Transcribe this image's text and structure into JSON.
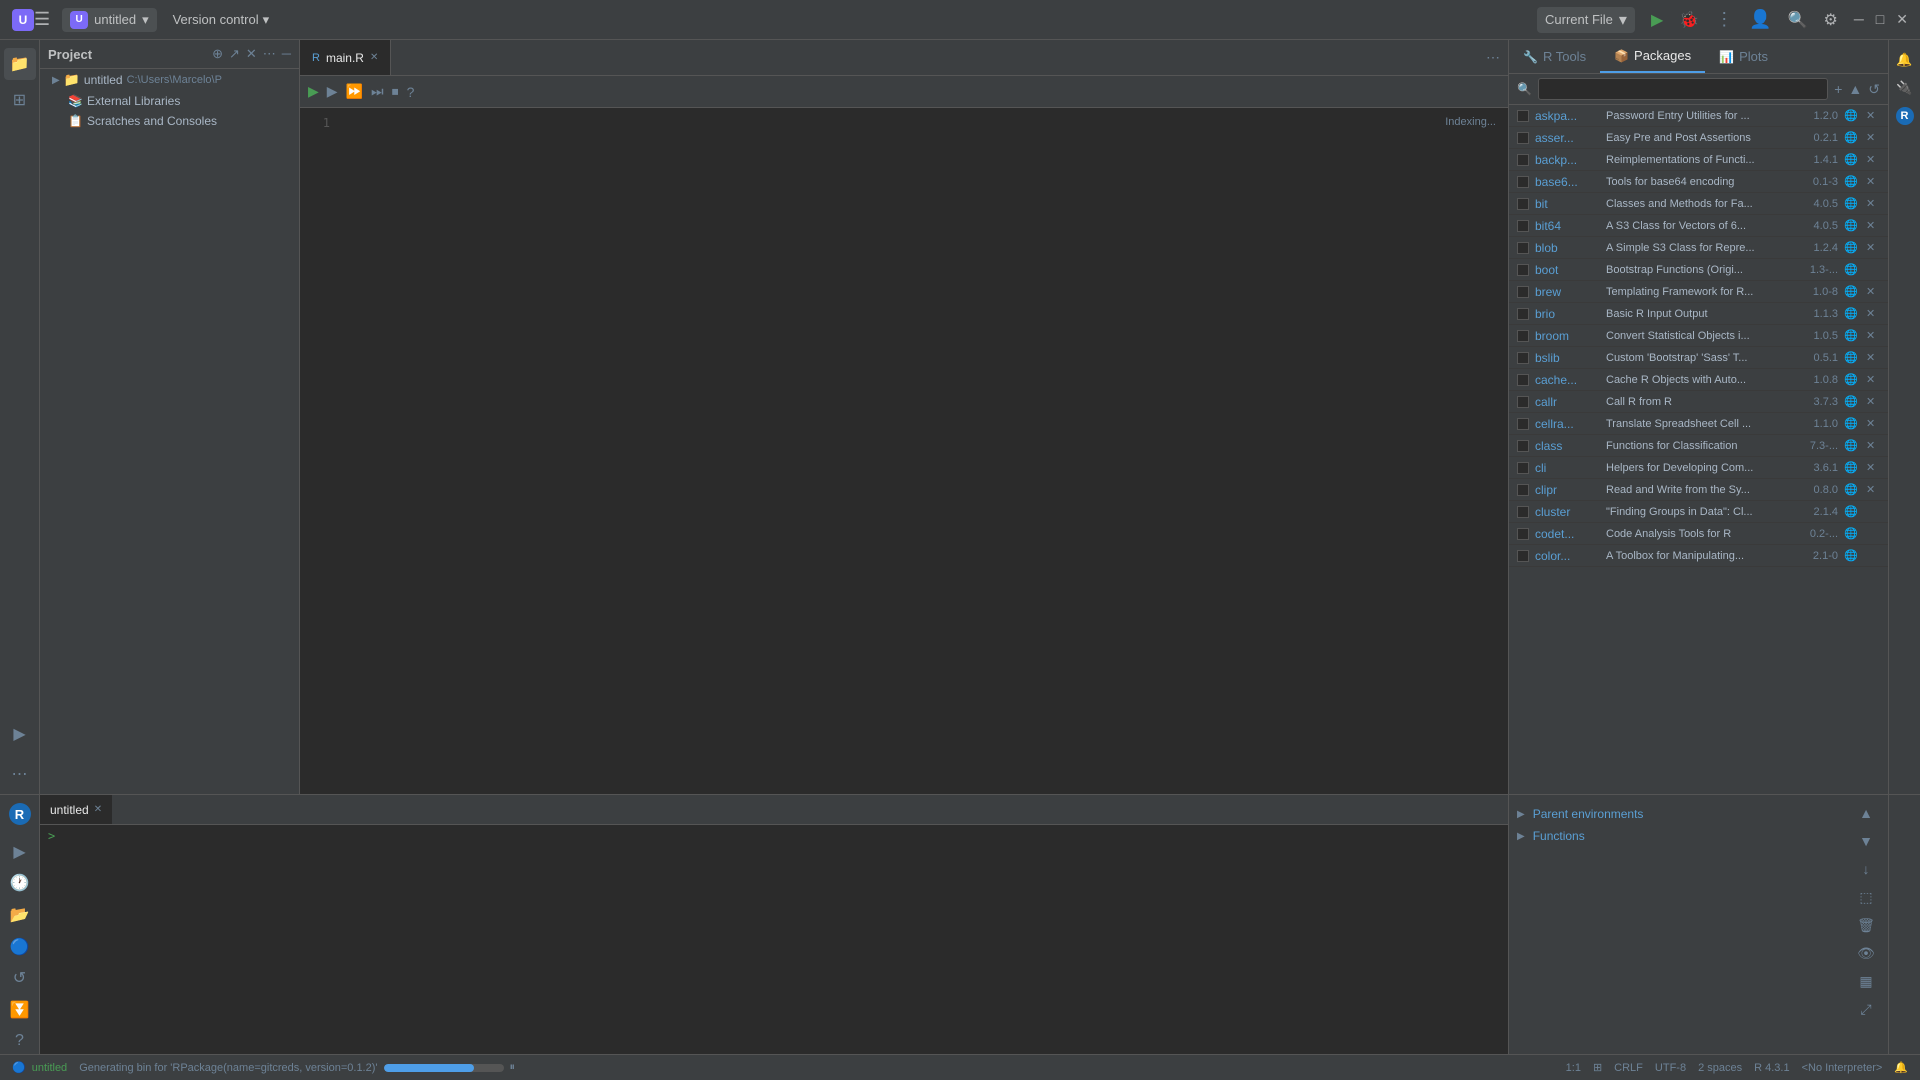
{
  "titlebar": {
    "project_name": "untitled",
    "version_control": "Version control",
    "chevron": "▾",
    "menu_icon": "☰",
    "current_file": "Current File",
    "icons": {
      "run": "▶",
      "bug": "🐞",
      "more": "⋮",
      "profile": "👤",
      "search": "🔍",
      "settings": "⚙"
    },
    "window_controls": {
      "minimize": "─",
      "maximize": "□",
      "close": "✕"
    }
  },
  "project_panel": {
    "title": "Project",
    "icons": [
      "⊕",
      "↗",
      "✕",
      "⋯",
      "─"
    ],
    "tree": [
      {
        "indent": 0,
        "arrow": "▶",
        "icon": "folder",
        "name": "untitled",
        "path": "C:\\Users\\Marcelo\\P",
        "type": "root"
      },
      {
        "indent": 1,
        "arrow": "",
        "icon": "lib",
        "name": "External Libraries",
        "path": "",
        "type": "library"
      },
      {
        "indent": 1,
        "arrow": "",
        "icon": "scratch",
        "name": "Scratches and Consoles",
        "path": "",
        "type": "scratch"
      }
    ]
  },
  "editor": {
    "tabs": [
      {
        "label": "main.R",
        "icon": "R",
        "active": true
      }
    ],
    "toolbar": {
      "run_btn": "▶",
      "run_line_btn": "▶",
      "run_all_btn": "⏩",
      "debug_btn": "⏭",
      "debug_stop_btn": "⏹",
      "help_btn": "?"
    },
    "lines": [
      {
        "num": 1,
        "code": ""
      }
    ],
    "indexing_label": "Indexing..."
  },
  "r_tools_panel": {
    "tabs": [
      {
        "label": "R Tools",
        "active": false
      },
      {
        "label": "Packages",
        "active": true
      },
      {
        "label": "Plots",
        "active": false
      }
    ],
    "search_placeholder": "",
    "packages": [
      {
        "checked": false,
        "name": "askpa...",
        "desc": "Password Entry Utilities for ...",
        "ver": "1.2.0",
        "globe": true,
        "del": true
      },
      {
        "checked": false,
        "name": "asser...",
        "desc": "Easy Pre and Post Assertions",
        "ver": "0.2.1",
        "globe": true,
        "del": true
      },
      {
        "checked": false,
        "name": "backp...",
        "desc": "Reimplementations of Functi...",
        "ver": "1.4.1",
        "globe": true,
        "del": true
      },
      {
        "checked": false,
        "name": "base6...",
        "desc": "Tools for base64 encoding",
        "ver": "0.1-3",
        "globe": true,
        "del": true
      },
      {
        "checked": false,
        "name": "bit",
        "desc": "Classes and Methods for Fa...",
        "ver": "4.0.5",
        "globe": true,
        "del": true
      },
      {
        "checked": false,
        "name": "bit64",
        "desc": "A S3 Class for Vectors of 6...",
        "ver": "4.0.5",
        "globe": true,
        "del": true
      },
      {
        "checked": false,
        "name": "blob",
        "desc": "A Simple S3 Class for Repre...",
        "ver": "1.2.4",
        "globe": true,
        "del": true
      },
      {
        "checked": false,
        "name": "boot",
        "desc": "Bootstrap Functions (Origi...",
        "ver": "1.3-...",
        "globe": true,
        "del": false
      },
      {
        "checked": false,
        "name": "brew",
        "desc": "Templating Framework for R...",
        "ver": "1.0-8",
        "globe": true,
        "del": true
      },
      {
        "checked": false,
        "name": "brio",
        "desc": "Basic R Input Output",
        "ver": "1.1.3",
        "globe": true,
        "del": true
      },
      {
        "checked": false,
        "name": "broom",
        "desc": "Convert Statistical Objects i...",
        "ver": "1.0.5",
        "globe": true,
        "del": true
      },
      {
        "checked": false,
        "name": "bslib",
        "desc": "Custom 'Bootstrap' 'Sass' T...",
        "ver": "0.5.1",
        "globe": true,
        "del": true
      },
      {
        "checked": false,
        "name": "cache...",
        "desc": "Cache R Objects with Auto...",
        "ver": "1.0.8",
        "globe": true,
        "del": true
      },
      {
        "checked": false,
        "name": "callr",
        "desc": "Call R from R",
        "ver": "3.7.3",
        "globe": true,
        "del": true
      },
      {
        "checked": false,
        "name": "cellra...",
        "desc": "Translate Spreadsheet Cell ...",
        "ver": "1.1.0",
        "globe": true,
        "del": true
      },
      {
        "checked": false,
        "name": "class",
        "desc": "Functions for Classification",
        "ver": "7.3-...",
        "globe": true,
        "del": true
      },
      {
        "checked": false,
        "name": "cli",
        "desc": "Helpers for Developing Com...",
        "ver": "3.6.1",
        "globe": true,
        "del": true
      },
      {
        "checked": false,
        "name": "clipr",
        "desc": "Read and Write from the Sy...",
        "ver": "0.8.0",
        "globe": true,
        "del": true
      },
      {
        "checked": false,
        "name": "cluster",
        "desc": "\"Finding Groups in Data\": Cl...",
        "ver": "2.1.4",
        "globe": true,
        "del": false
      },
      {
        "checked": false,
        "name": "codet...",
        "desc": "Code Analysis Tools for R",
        "ver": "0.2-...",
        "globe": true,
        "del": false
      },
      {
        "checked": false,
        "name": "color...",
        "desc": "A Toolbox for Manipulating...",
        "ver": "2.1-0",
        "globe": true,
        "del": false
      }
    ]
  },
  "console": {
    "tabs": [
      {
        "label": "untitled",
        "active": true
      }
    ],
    "prompt": ">"
  },
  "environment": {
    "items": [
      {
        "label": "Parent environments",
        "arrow": "▶"
      },
      {
        "label": "Functions",
        "arrow": "▶"
      }
    ],
    "toolbar_icons": [
      "▲",
      "▼",
      "↓",
      "⬚",
      "🗑",
      "👁",
      "▦",
      "⤢"
    ]
  },
  "statusbar": {
    "project": "untitled",
    "generating_msg": "Generating bin for 'RPackage(name=gitcreds, version=0.1.2)'",
    "progress_pct": 75,
    "pause_icon": "⏸",
    "cursor_pos": "1:1",
    "encoding": "UTF-8",
    "line_sep": "CRLF",
    "indent": "2 spaces",
    "r_version": "R 4.3.1",
    "interpreter": "<No Interpreter>"
  }
}
